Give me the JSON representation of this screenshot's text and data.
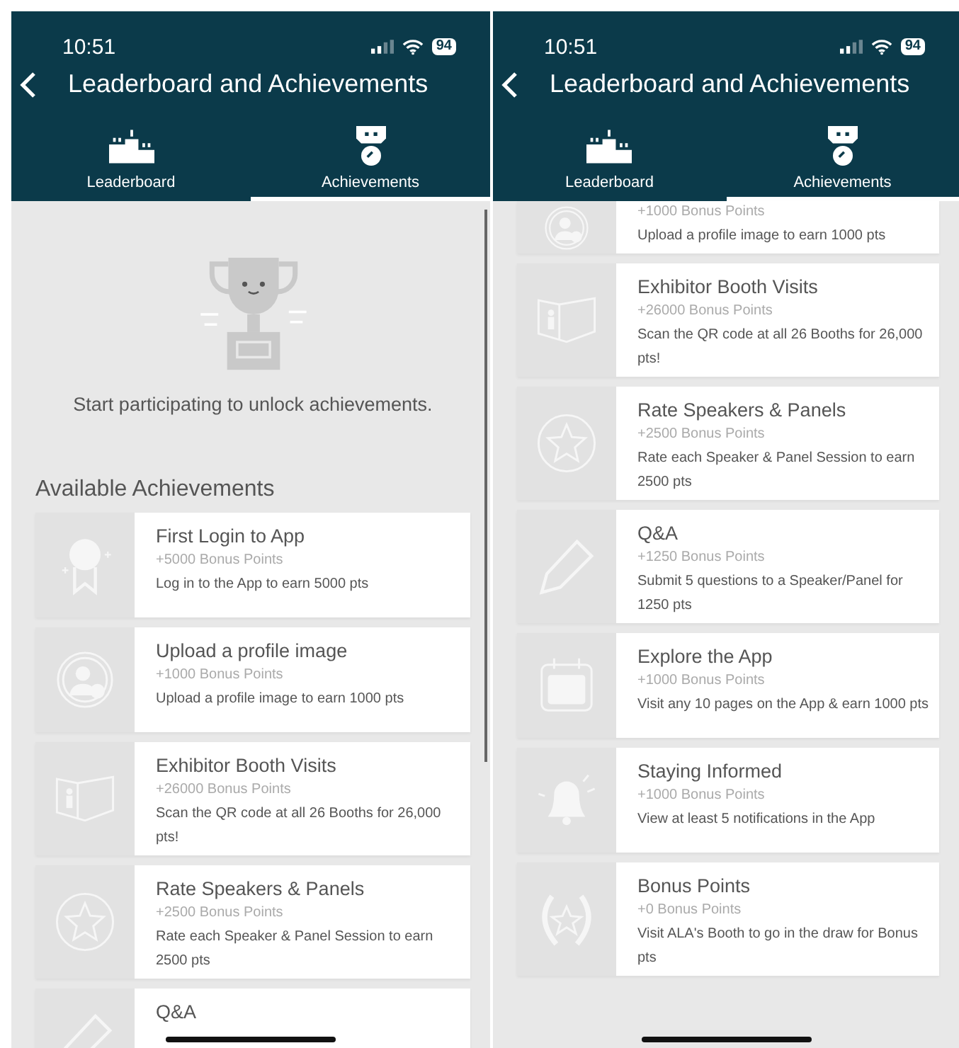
{
  "screens": [
    {
      "status_bar": {
        "time": "10:51",
        "battery": "94"
      },
      "title": "Leaderboard and Achievements",
      "tabs": [
        {
          "label": "Leaderboard",
          "kind": "podium",
          "selected": false
        },
        {
          "label": "Achievements",
          "kind": "medal",
          "selected": true
        }
      ],
      "empty_state": {
        "message": "Start participating to unlock achievements."
      },
      "section_title": "Available Achievements",
      "achievements": [
        {
          "kind": "ribbon",
          "title": "First Login to App",
          "points": "+5000 Bonus Points",
          "description": "Log in to the App to earn 5000 pts"
        },
        {
          "kind": "profile",
          "title": "Upload a profile image",
          "points": "+1000 Bonus Points",
          "description": "Upload a profile image to earn 1000 pts"
        },
        {
          "kind": "booth",
          "title": "Exhibitor Booth Visits",
          "points": "+26000 Bonus Points",
          "description": "Scan the QR code at all 26 Booths for 26,000 pts!"
        },
        {
          "kind": "star",
          "title": "Rate Speakers & Panels",
          "points": "+2500 Bonus Points",
          "description": "Rate each Speaker & Panel Session to earn 2500 pts"
        },
        {
          "kind": "pencil",
          "title": "Q&A"
        }
      ]
    },
    {
      "status_bar": {
        "time": "10:51",
        "battery": "94"
      },
      "title": "Leaderboard and Achievements",
      "tabs": [
        {
          "label": "Leaderboard",
          "kind": "podium",
          "selected": false
        },
        {
          "label": "Achievements",
          "kind": "medal",
          "selected": true
        }
      ],
      "achievements": [
        {
          "kind": "profile",
          "points": "+1000 Bonus Points",
          "description": "Upload a profile image to earn 1000 pts"
        },
        {
          "kind": "booth",
          "title": "Exhibitor Booth Visits",
          "points": "+26000 Bonus Points",
          "description": "Scan the QR code at all 26 Booths for 26,000 pts!"
        },
        {
          "kind": "star",
          "title": "Rate Speakers & Panels",
          "points": "+2500 Bonus Points",
          "description": "Rate each Speaker & Panel Session to earn 2500 pts"
        },
        {
          "kind": "pencil",
          "title": "Q&A",
          "points": "+1250 Bonus Points",
          "description": "Submit 5 questions to a Speaker/Panel for 1250 pts"
        },
        {
          "kind": "calendar",
          "title": "Explore the App",
          "points": "+1000 Bonus Points",
          "description": "Visit any 10 pages on the App & earn 1000 pts"
        },
        {
          "kind": "bell",
          "title": "Staying Informed",
          "points": "+1000 Bonus Points",
          "description": "View at least 5 notifications in the App"
        },
        {
          "kind": "wreath",
          "title": "Bonus Points",
          "points": "+0 Bonus Points",
          "description": "Visit ALA's Booth to go in the draw for Bonus pts"
        }
      ]
    }
  ]
}
